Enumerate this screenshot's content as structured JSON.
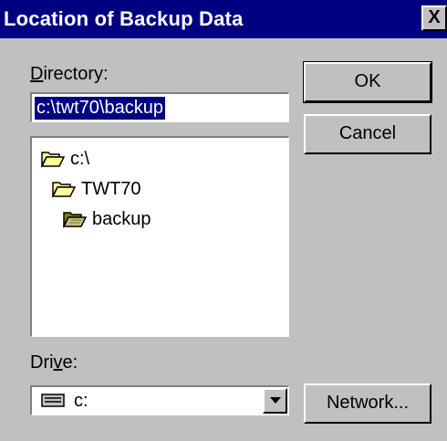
{
  "window": {
    "title": "Location of Backup Data",
    "close_symbol": "X"
  },
  "directory": {
    "label": "Directory:",
    "label_access_key": "D",
    "label_rest": "irectory:",
    "value": "c:\\twt70\\backup"
  },
  "tree": {
    "items": [
      {
        "label": "c:\\",
        "icon": "open-folder-icon"
      },
      {
        "label": "TWT70",
        "icon": "open-folder-icon"
      },
      {
        "label": "backup",
        "icon": "open-folder-shaded-icon"
      }
    ]
  },
  "drive": {
    "label": "Drive:",
    "label_before": "Dri",
    "label_access_key": "v",
    "label_after": "e:",
    "value": "c:",
    "icon": "drive-icon"
  },
  "buttons": {
    "ok": "OK",
    "cancel": "Cancel",
    "network": "Network..."
  }
}
